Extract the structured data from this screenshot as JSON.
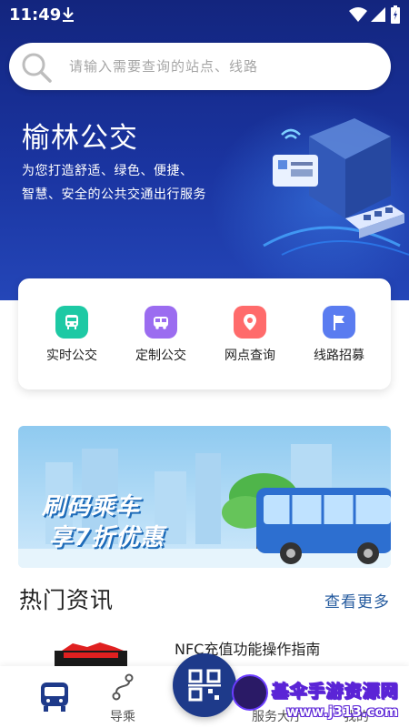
{
  "status_bar": {
    "time": "11:49"
  },
  "search": {
    "placeholder": "请输入需要查询的站点、线路"
  },
  "hero": {
    "title": "榆林公交",
    "subtitle_line1": "为您打造舒适、绿色、便捷、",
    "subtitle_line2": "智慧、安全的公共交通出行服务"
  },
  "functions": [
    {
      "label": "实时公交",
      "icon": "bus-icon",
      "color": "#1dc9a4"
    },
    {
      "label": "定制公交",
      "icon": "custom-bus-icon",
      "color": "#9b6cf0"
    },
    {
      "label": "网点查询",
      "icon": "location-pin-icon",
      "color": "#ff6b6b"
    },
    {
      "label": "线路招募",
      "icon": "flag-icon",
      "color": "#5a7cf0"
    }
  ],
  "banner": {
    "line1": "刷码乘车",
    "line2": "享7折优惠"
  },
  "news": {
    "section_title": "热门资讯",
    "more_link": "查看更多",
    "items": [
      {
        "title": "NFC充值功能操作指南"
      }
    ]
  },
  "bottom_nav": {
    "items": [
      {
        "label": "",
        "icon": "bus-icon"
      },
      {
        "label": "导乘",
        "icon": "route-icon"
      },
      {
        "label": "服务大厅",
        "icon": "service-icon"
      },
      {
        "label": "我的",
        "icon": "user-icon"
      }
    ],
    "scan_icon": "qr-scan-icon"
  },
  "watermark": {
    "title": "基伞手游资源网",
    "url": "www.j313.com"
  },
  "colors": {
    "hero_top": "#13257e",
    "hero_bottom": "#2446b8",
    "accent_link": "#245a9e",
    "nav_active": "#1e3a8a"
  }
}
